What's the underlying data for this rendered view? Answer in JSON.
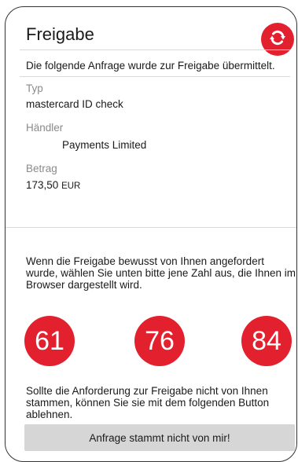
{
  "header": {
    "title": "Freigabe",
    "refresh_icon": "refresh-icon"
  },
  "request": {
    "intro": "Die folgende Anfrage wurde zur Freigabe übermittelt.",
    "type_label": "Typ",
    "type_value": "mastercard ID check",
    "merchant_label": "Händler",
    "merchant_value": "Payments Limited",
    "amount_label": "Betrag",
    "amount_value": "173,50",
    "amount_currency": "EUR"
  },
  "confirmation": {
    "instruction": "Wenn die Freigabe bewusst von Ihnen angefordert wurde, wählen Sie unten bitte jene Zahl aus, die Ihnen im Browser dargestellt wird.",
    "numbers": [
      "61",
      "76",
      "84"
    ]
  },
  "rejection": {
    "text": "Sollte die Anforderung zur Freigabe nicht von Ihnen stammen, können Sie sie mit dem folgenden Button ablehnen.",
    "button_label": "Anfrage stammt nicht von mir!"
  },
  "colors": {
    "accent": "#e3202e",
    "button_gray": "#d6d6d6",
    "label_gray": "#8a8a8a"
  }
}
